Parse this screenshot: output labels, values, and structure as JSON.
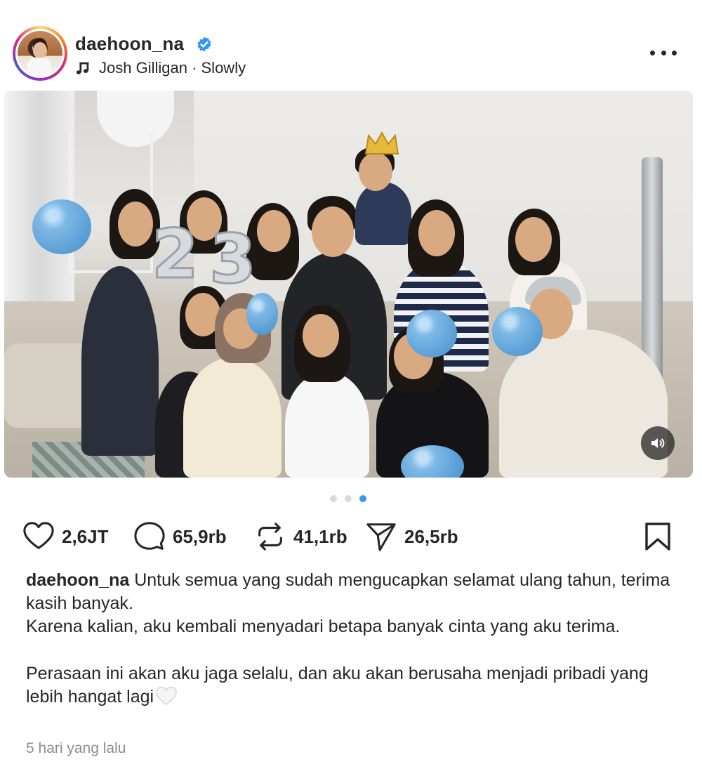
{
  "post": {
    "author": {
      "username": "daehoon_na",
      "verified": true,
      "avatar_icon": "profile-photo"
    },
    "music": {
      "icon": "music-note-icon",
      "label": "Josh Gilligan · Slowly"
    },
    "more_icon": "more-horizontal-icon",
    "media": {
      "type": "photo-carousel",
      "sound_icon": "volume-on-icon",
      "balloon_digits": [
        "2",
        "3"
      ]
    },
    "carousel": {
      "total": 3,
      "active_index": 2
    },
    "actions": {
      "like": {
        "icon": "heart-icon",
        "count": "2,6JT"
      },
      "comment": {
        "icon": "comment-icon",
        "count": "65,9rb"
      },
      "repost": {
        "icon": "repost-icon",
        "count": "41,1rb"
      },
      "share": {
        "icon": "send-icon",
        "count": "26,5rb"
      },
      "save": {
        "icon": "bookmark-icon"
      }
    },
    "caption": {
      "username": "daehoon_na",
      "line1": "Untuk semua yang sudah mengucapkan selamat ulang tahun, terima kasih banyak.",
      "line2": "Karena kalian, aku kembali menyadari betapa banyak cinta yang aku terima.",
      "line3": "Perasaan ini akan aku jaga selalu, dan aku akan berusaha menjadi pribadi yang lebih hangat lagi",
      "emoji": "white-heart-emoji"
    },
    "timestamp": "5 hari yang lalu"
  },
  "colors": {
    "text": "#262626",
    "muted": "#8e8e8e",
    "verified": "#3897f0",
    "dot_active": "#3897f0",
    "dot_inactive": "#dbdbdb"
  }
}
